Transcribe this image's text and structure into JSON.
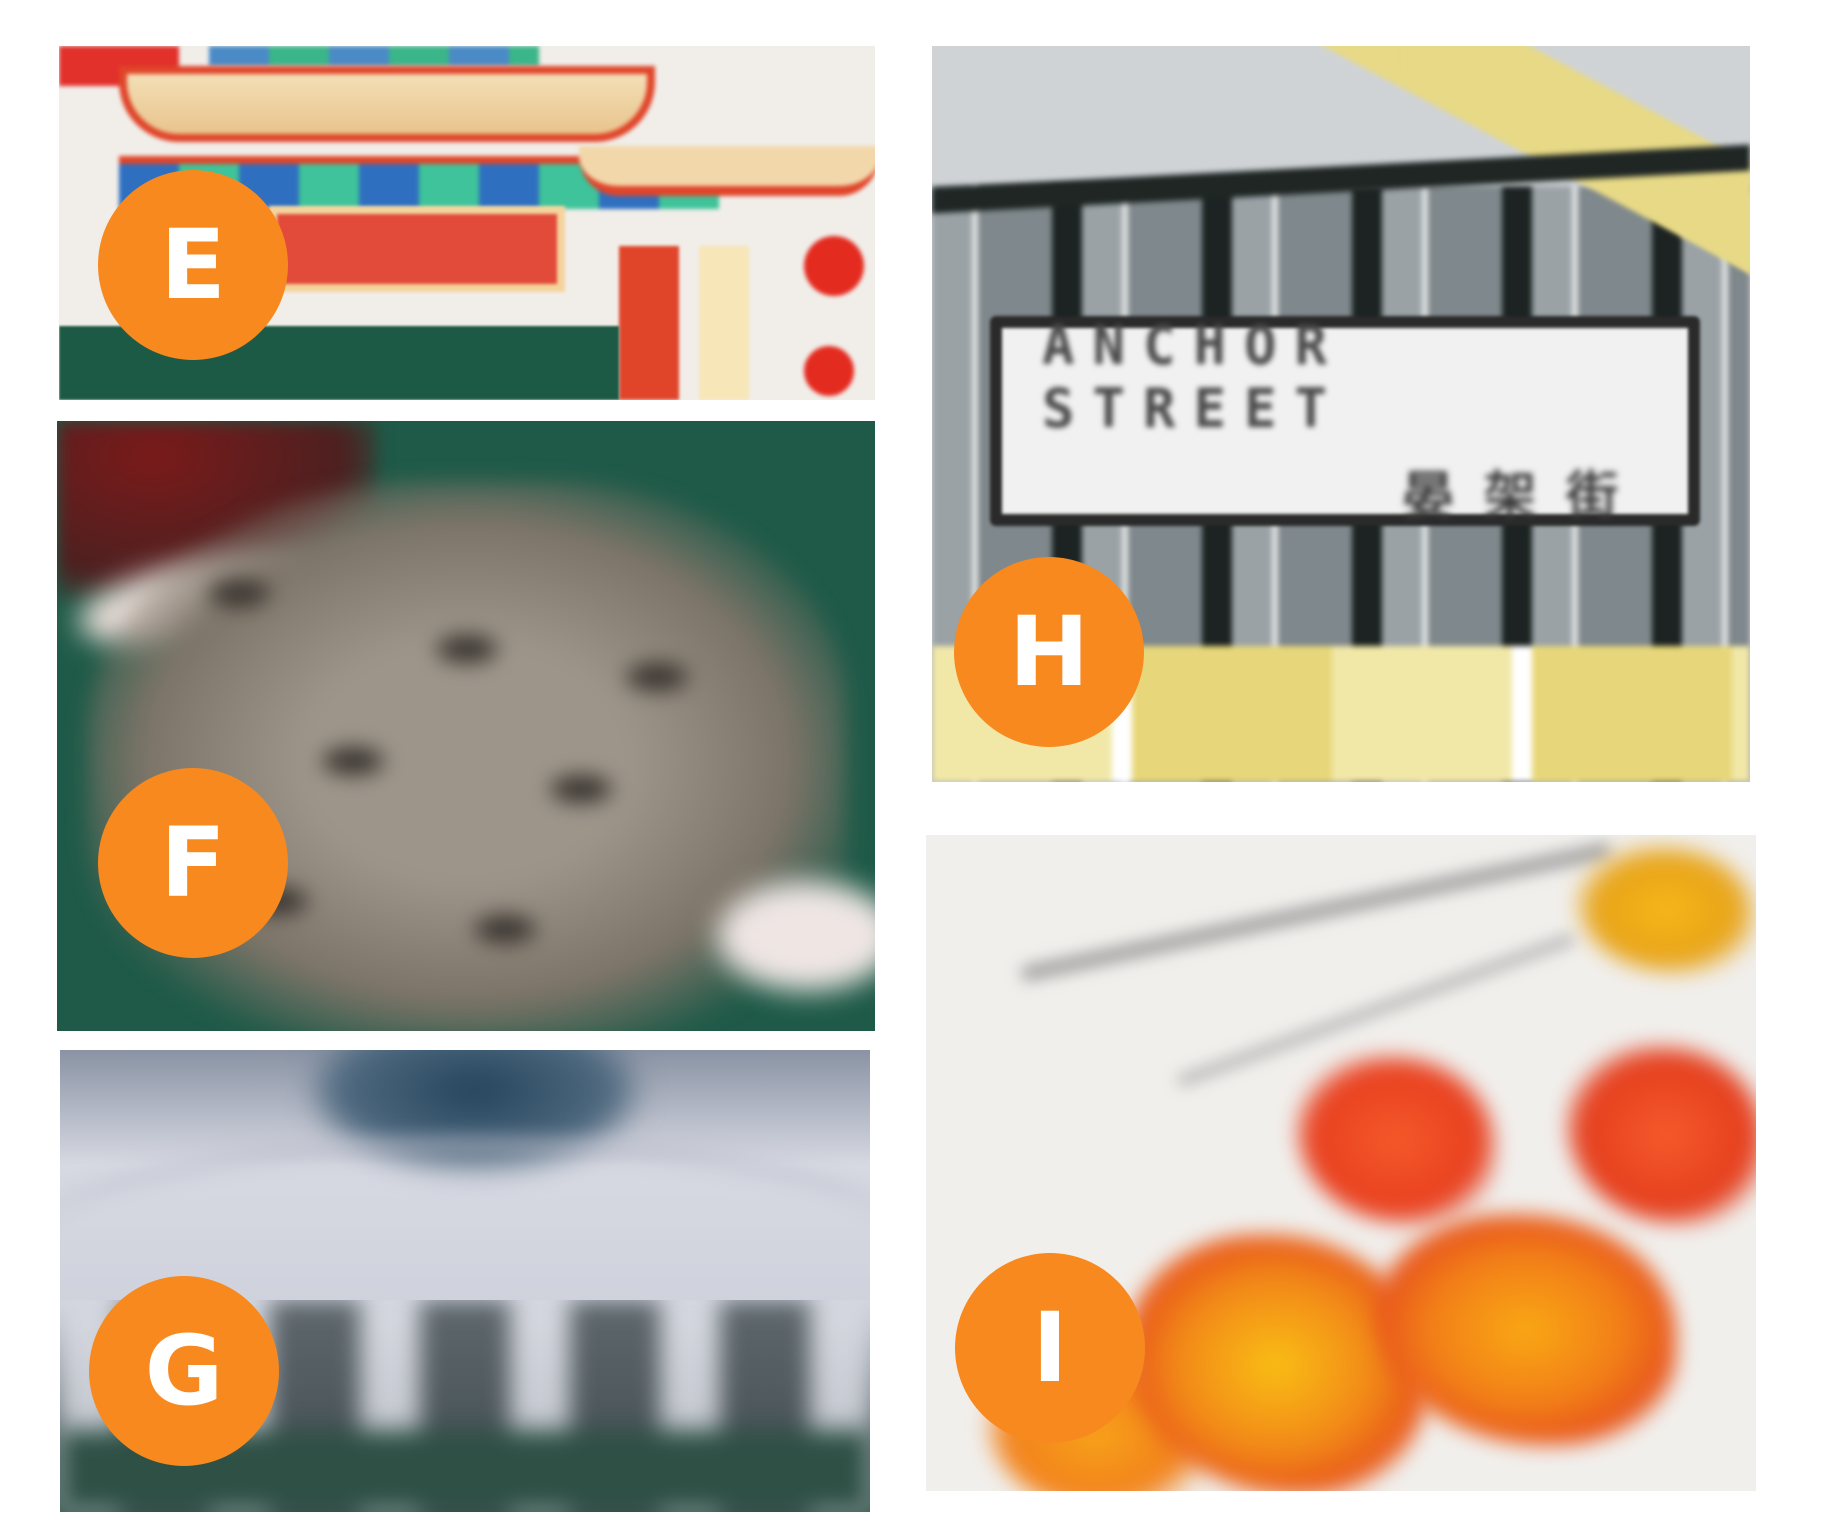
{
  "theme": {
    "badge_bg": "#f7891f",
    "badge_fg": "#ffffff",
    "page_bg": "#ffffff"
  },
  "panels": [
    {
      "id": "E",
      "label": "E",
      "subject": "pagoda-gate"
    },
    {
      "id": "F",
      "label": "F",
      "subject": "dragon-scales"
    },
    {
      "id": "G",
      "label": "G",
      "subject": "gear-wheel"
    },
    {
      "id": "H",
      "label": "H",
      "subject": "street-sign-building",
      "sign_text_en": "ANCHOR STREET",
      "sign_text_zh": "晏架街"
    },
    {
      "id": "I",
      "label": "I",
      "subject": "maple-leaves"
    }
  ]
}
